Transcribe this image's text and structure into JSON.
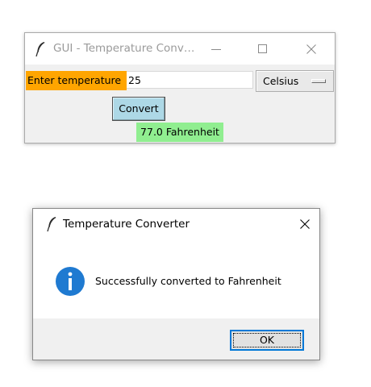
{
  "main_window": {
    "title": "GUI - Temperature Conv…",
    "controls": [
      "minimize-icon",
      "maximize-icon",
      "close-icon"
    ],
    "temperature_label": "Enter temperature",
    "temperature_value": "25",
    "unit_selected": "Celsius",
    "convert_label": "Convert",
    "result_text": "77.0 Fahrenheit",
    "colors": {
      "label_bg": "#ffa500",
      "button_bg": "#add8e6",
      "result_bg": "#90ee90"
    }
  },
  "dialog": {
    "title": "Temperature Converter",
    "icon": "info-icon",
    "message": "Successfully converted to Fahrenheit",
    "ok_label": "OK",
    "colors": {
      "info_icon": "#1f7ad1",
      "ok_border": "#0078d7"
    }
  }
}
